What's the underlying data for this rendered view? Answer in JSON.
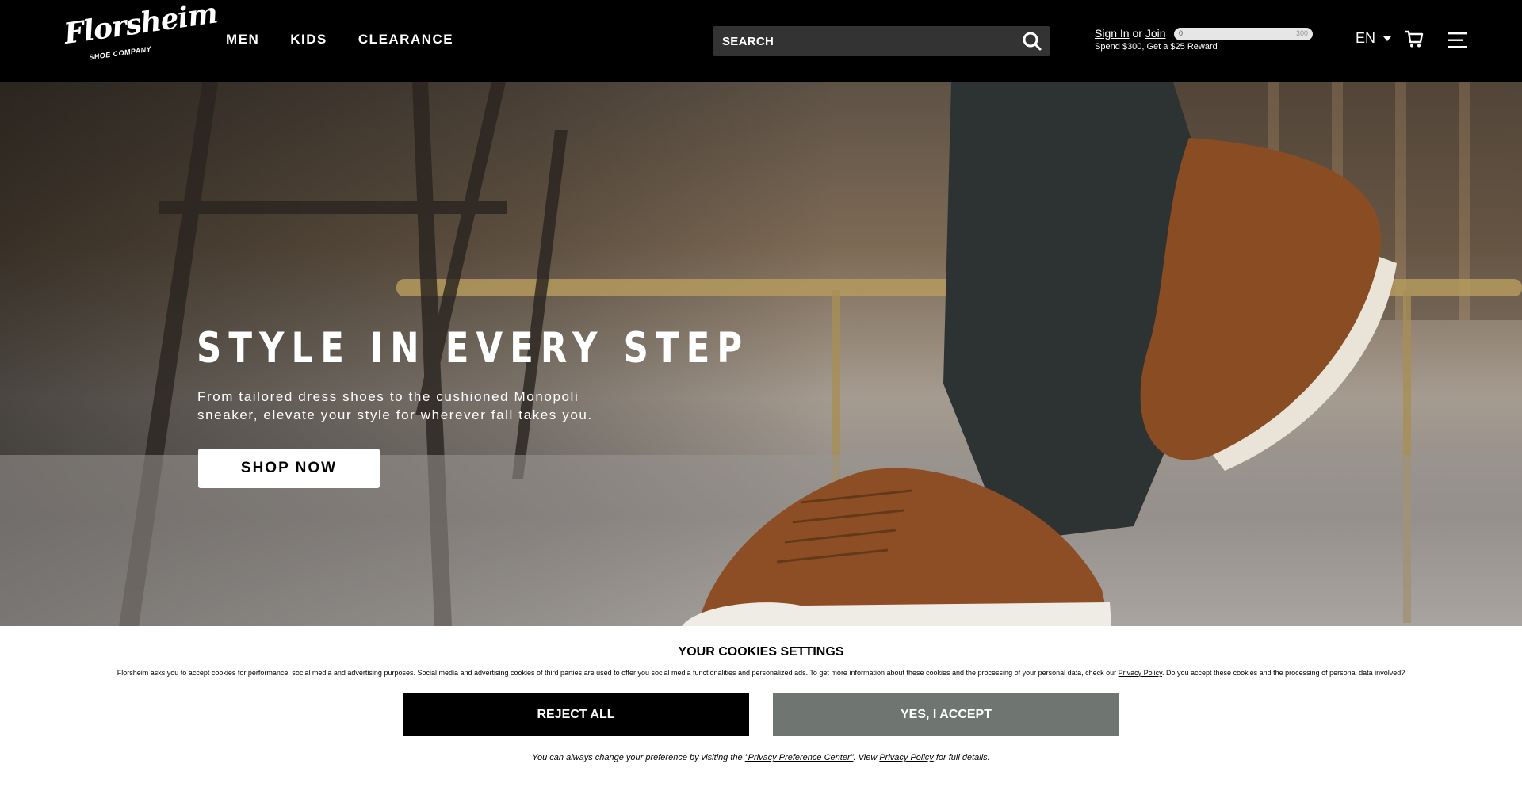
{
  "brand": {
    "name": "Florsheim",
    "sub": "SHOE COMPANY"
  },
  "nav": {
    "items": [
      {
        "label": "MEN"
      },
      {
        "label": "KIDS"
      },
      {
        "label": "CLEARANCE"
      }
    ]
  },
  "search": {
    "placeholder": "SEARCH",
    "icon": "search-icon"
  },
  "account": {
    "sign_in": "Sign In",
    "or": "or",
    "join": "Join",
    "reward_text": "Spend $300, Get a $25 Reward",
    "progress": {
      "min": "0",
      "max": "300",
      "current": 0
    }
  },
  "language": {
    "selected": "EN"
  },
  "icons": {
    "cart": "cart-icon",
    "menu": "hamburger-menu-icon",
    "caret": "caret-down-icon"
  },
  "hero": {
    "title": "STYLE IN EVERY STEP",
    "subtitle": "From tailored dress shoes to the cushioned Monopoli sneaker, elevate your style for wherever fall takes you.",
    "cta": "SHOP NOW"
  },
  "cookies": {
    "title": "YOUR COOKIES SETTINGS",
    "text_before": "Florsheim asks you to accept cookies for performance, social media and advertising purposes. Social media and advertising cookies of third parties are used to offer you social media functionalities and personalized ads. To get more information about these cookies and the processing of your personal data, check our ",
    "privacy_link": "Privacy Policy",
    "text_after": ". Do you accept these cookies and the processing of personal data involved?",
    "reject": "REJECT ALL",
    "accept": "YES, I ACCEPT",
    "foot_before": "You can always change your preference by visiting the ",
    "foot_center_link": "\"Privacy Preference Center\"",
    "foot_mid": ". View ",
    "foot_policy_link": "Privacy Policy",
    "foot_after": " for full details."
  },
  "colors": {
    "header_bg": "#000000",
    "search_bg": "#333333",
    "accept_bg": "#6f7672",
    "reject_bg": "#000000"
  }
}
